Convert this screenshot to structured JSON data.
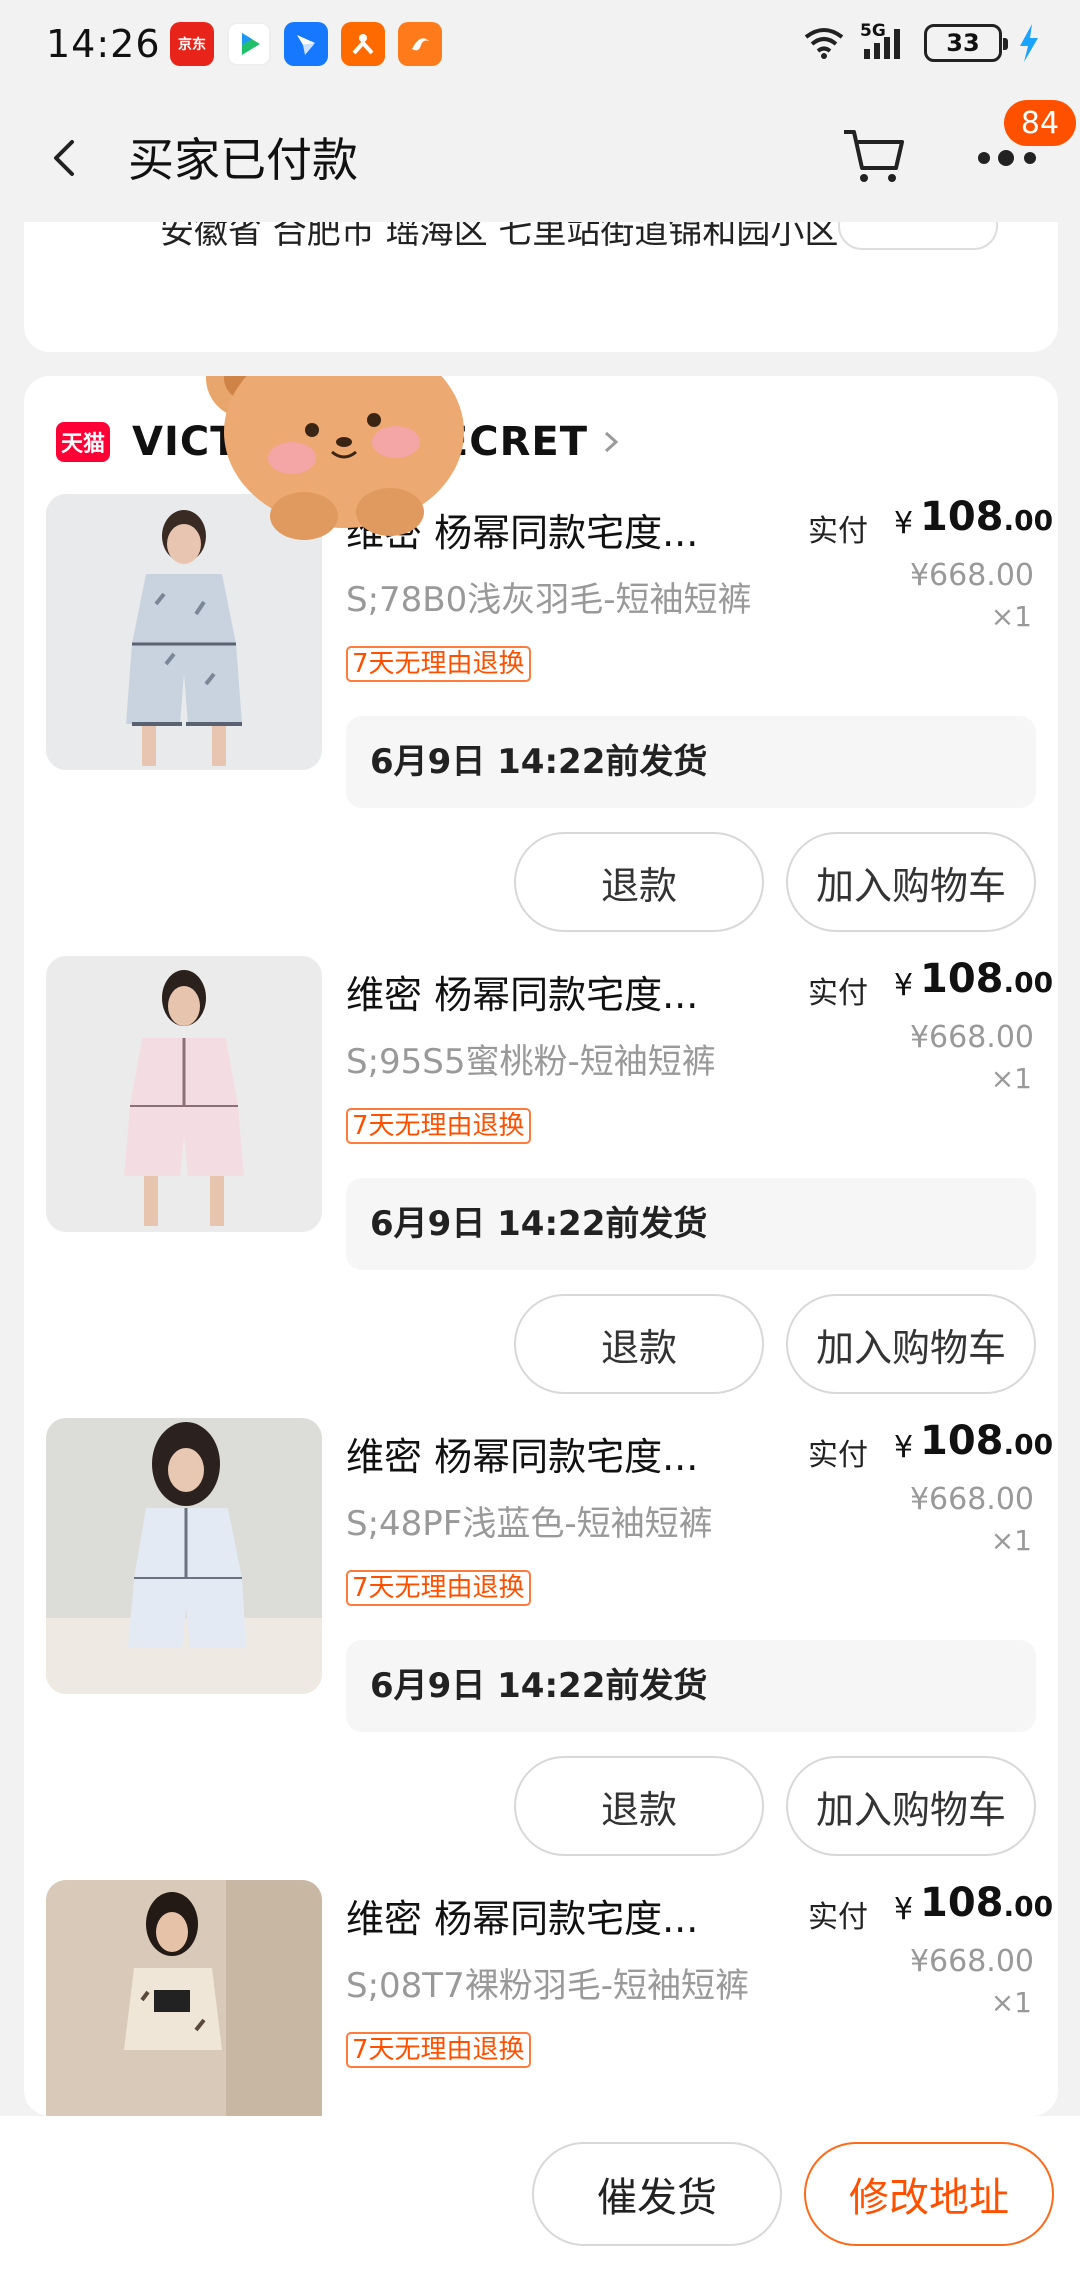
{
  "status_bar": {
    "time": "14:26",
    "apps": [
      {
        "name": "jd-app-icon",
        "label": "京东",
        "color": "#e8231a"
      },
      {
        "name": "video-app-icon",
        "label": "▶",
        "color": "#ffffff"
      },
      {
        "name": "feishu-app-icon",
        "label": "",
        "color": "#1677ff"
      },
      {
        "name": "taobao-app-icon",
        "label": "",
        "color": "#ff6a00"
      },
      {
        "name": "uc-app-icon",
        "label": "",
        "color": "#ff7a1a"
      }
    ],
    "network": "5G",
    "battery": "33"
  },
  "nav": {
    "title": "买家已付款",
    "badge_count": "84"
  },
  "address": {
    "text": "安徽省 合肥市 瑶海区 七里站街道锦和园小区"
  },
  "shop": {
    "logo_text": "天猫",
    "name": "VICTORIA'S SECRET"
  },
  "items": [
    {
      "title": "维密 杨幂同款宅度...",
      "sku": "S;78B0浅灰羽毛-短袖短裤",
      "tag": "7天无理由退换",
      "price_label": "实付",
      "price_yen": "¥",
      "price_int": "108",
      "price_dec": ".00",
      "orig_price": "¥668.00",
      "qty": "×1",
      "ship": "6月9日 14:22前发货",
      "refund_label": "退款",
      "addcart_label": "加入购物车",
      "colors": {
        "bg": "#e9eaec",
        "top": "#c9d3df",
        "accent": "#7b8696"
      }
    },
    {
      "title": "维密 杨幂同款宅度...",
      "sku": "S;95S5蜜桃粉-短袖短裤",
      "tag": "7天无理由退换",
      "price_label": "实付",
      "price_yen": "¥",
      "price_int": "108",
      "price_dec": ".00",
      "orig_price": "¥668.00",
      "qty": "×1",
      "ship": "6月9日 14:22前发货",
      "refund_label": "退款",
      "addcart_label": "加入购物车",
      "colors": {
        "bg": "#ebebeb",
        "top": "#f3dde3",
        "accent": "#8c6f78"
      }
    },
    {
      "title": "维密 杨幂同款宅度...",
      "sku": "S;48PF浅蓝色-短袖短裤",
      "tag": "7天无理由退换",
      "price_label": "实付",
      "price_yen": "¥",
      "price_int": "108",
      "price_dec": ".00",
      "orig_price": "¥668.00",
      "qty": "×1",
      "ship": "6月9日 14:22前发货",
      "refund_label": "退款",
      "addcart_label": "加入购物车",
      "colors": {
        "bg": "#dcdcd8",
        "top": "#e3eaf3",
        "accent": "#6b7380"
      }
    },
    {
      "title": "维密 杨幂同款宅度...",
      "sku": "S;08T7裸粉羽毛-短袖短裤",
      "tag": "7天无理由退换",
      "price_label": "实付",
      "price_yen": "¥",
      "price_int": "108",
      "price_dec": ".00",
      "orig_price": "¥668.00",
      "qty": "×1",
      "ship": "",
      "refund_label": "",
      "addcart_label": "",
      "colors": {
        "bg": "#d9c9b8",
        "top": "#efe6d8",
        "accent": "#5b4a3c"
      }
    }
  ],
  "bottom": {
    "urge_label": "催发货",
    "change_address_label": "修改地址"
  },
  "colors": {
    "accent": "#ff5000",
    "tmall_red": "#ff0036"
  }
}
